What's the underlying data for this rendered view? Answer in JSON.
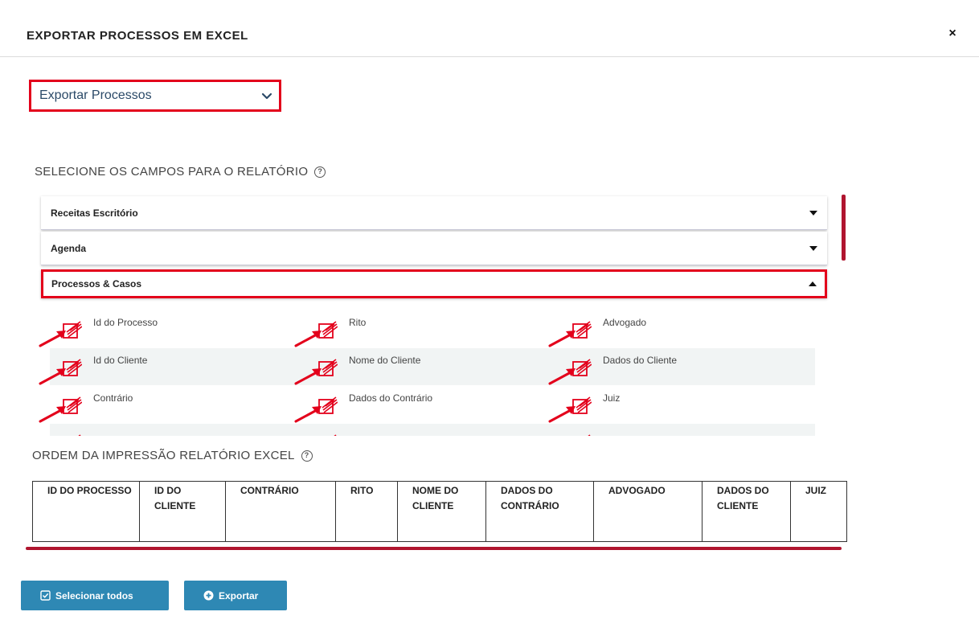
{
  "modal": {
    "title": "EXPORTAR PROCESSOS EM EXCEL",
    "close": "×"
  },
  "export_select": {
    "value": "Exportar Processos"
  },
  "fields_section": {
    "title": "SELECIONE OS CAMPOS PARA O RELATÓRIO",
    "help": "?"
  },
  "accordions": [
    {
      "label": "Receitas Escritório",
      "state": "collapsed"
    },
    {
      "label": "Agenda",
      "state": "collapsed"
    },
    {
      "label": "Processos & Casos",
      "state": "expanded"
    }
  ],
  "fields": [
    [
      "Id do Processo",
      "Rito",
      "Advogado"
    ],
    [
      "Id do Cliente",
      "Nome do Cliente",
      "Dados do Cliente"
    ],
    [
      "Contrário",
      "Dados do Contrário",
      "Juiz"
    ]
  ],
  "order_section": {
    "title": "ORDEM DA IMPRESSÃO RELATÓRIO EXCEL",
    "help": "?"
  },
  "order_columns": [
    "ID DO PROCESSO",
    "ID DO CLIENTE",
    "CONTRÁRIO",
    "RITO",
    "NOME DO CLIENTE",
    "DADOS DO CONTRÁRIO",
    "ADVOGADO",
    "DADOS DO CLIENTE",
    "JUIZ"
  ],
  "buttons": {
    "select_all": "Selecionar todos",
    "export": "Exportar"
  },
  "colors": {
    "highlight_red": "#e3001b",
    "accent_dark_red": "#b0152f",
    "button_blue": "#2e88b4"
  },
  "icons": {
    "close": "close-icon",
    "dropdown": "chevron-down-icon",
    "help": "help-circle-icon",
    "field_checkbox": "checked-checkbox-icon",
    "select_all": "check-square-icon",
    "export": "plus-circle-icon"
  }
}
